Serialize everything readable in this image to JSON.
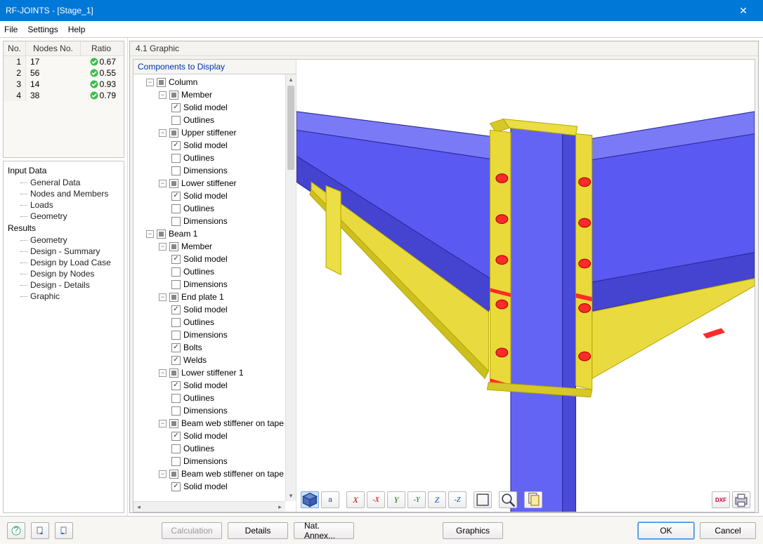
{
  "window": {
    "title": "RF-JOINTS - [Stage_1]"
  },
  "menu": {
    "file": "File",
    "settings": "Settings",
    "help": "Help"
  },
  "grid": {
    "headers": {
      "no": "No.",
      "nodes": "Nodes No.",
      "ratio": "Ratio"
    },
    "rows": [
      {
        "no": "1",
        "nodes": "17",
        "ratio": "0.67"
      },
      {
        "no": "2",
        "nodes": "56",
        "ratio": "0.55"
      },
      {
        "no": "3",
        "nodes": "14",
        "ratio": "0.93"
      },
      {
        "no": "4",
        "nodes": "38",
        "ratio": "0.79"
      }
    ]
  },
  "nav": {
    "input": "Input Data",
    "input_items": [
      "General Data",
      "Nodes and Members",
      "Loads",
      "Geometry"
    ],
    "results": "Results",
    "results_items": [
      "Geometry",
      "Design - Summary",
      "Design by Load Case",
      "Design by Nodes",
      "Design - Details",
      "Graphic"
    ]
  },
  "panel": {
    "title": "4.1 Graphic"
  },
  "ctree": {
    "title": "Components to Display",
    "column": "Column",
    "member": "Member",
    "solid": "Solid model",
    "outlines": "Outlines",
    "upper_stiff": "Upper stiffener",
    "dimensions": "Dimensions",
    "lower_stiff": "Lower stiffener",
    "beam1": "Beam 1",
    "endplate1": "End plate 1",
    "bolts": "Bolts",
    "welds": "Welds",
    "lower_stiff1": "Lower stiffener 1",
    "bw_stiff": "Beam web stiffener on tape"
  },
  "toolbar": {
    "iso": "iso",
    "ortho": "ortho",
    "xp": "X",
    "xm": "-X",
    "yp": "Y",
    "ym": "-Y",
    "zp": "Z",
    "zm": "-Z",
    "box": "box",
    "zoom": "zoom",
    "copy": "copy",
    "dxf": "DXF",
    "print": "print"
  },
  "footer": {
    "help": "?",
    "b1": "b1",
    "b2": "b2",
    "calc": "Calculation",
    "details": "Details",
    "annex": "Nat. Annex...",
    "graphics": "Graphics",
    "ok": "OK",
    "cancel": "Cancel"
  }
}
